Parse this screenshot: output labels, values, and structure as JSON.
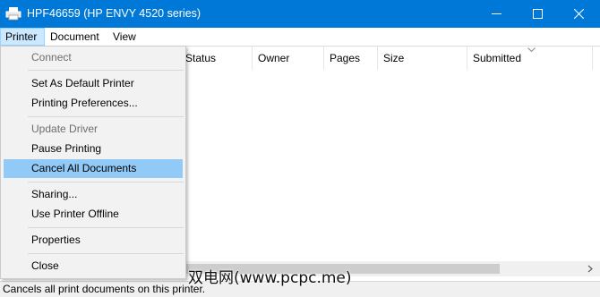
{
  "window": {
    "title": "HPF46659 (HP ENVY 4520 series)",
    "icon": "printer-icon",
    "accent_color": "#0078d7"
  },
  "menubar": {
    "printer": "Printer",
    "document": "Document",
    "view": "View"
  },
  "columns": {
    "status": "Status",
    "owner": "Owner",
    "pages": "Pages",
    "size": "Size",
    "submitted": "Submitted"
  },
  "printer_menu": {
    "connect": "Connect",
    "set_default": "Set As Default Printer",
    "preferences": "Printing Preferences...",
    "update_driver": "Update Driver",
    "pause": "Pause Printing",
    "cancel_all": "Cancel All Documents",
    "sharing": "Sharing...",
    "offline": "Use Printer Offline",
    "properties": "Properties",
    "close": "Close",
    "selected_item": "Cancel All Documents",
    "selected_color": "#91c9f7"
  },
  "statusbar": {
    "text": "Cancels all print documents on this printer."
  },
  "watermark": {
    "text": "双电网(www.pcpc.me)"
  }
}
